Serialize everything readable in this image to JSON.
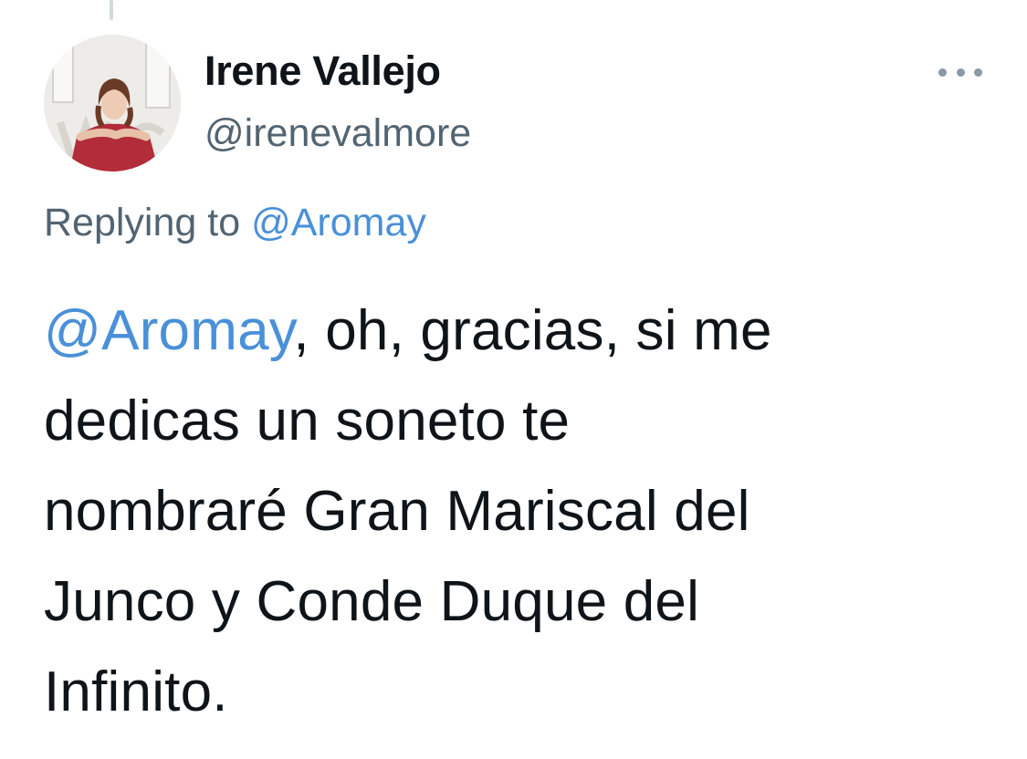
{
  "tweet": {
    "author": {
      "display_name": "Irene Vallejo",
      "handle": "@irenevalmore",
      "avatar": "avatar-photo"
    },
    "more_icon": "more-dots-icon",
    "reply_context": {
      "prefix": "Replying to",
      "mention": "@Aromay"
    },
    "body": {
      "mention": "@Aromay",
      "lines": [
        ", oh, gracias, si me",
        "dedicas un soneto te",
        "nombraré Gran Mariscal del",
        "Junco y Conde Duque del",
        "Infinito."
      ]
    }
  },
  "colors": {
    "text_primary": "#0f1419",
    "text_secondary": "#536471",
    "link": "#4a90d9",
    "thread_line": "#cfd9de",
    "icon_gray": "#8b98a5"
  }
}
